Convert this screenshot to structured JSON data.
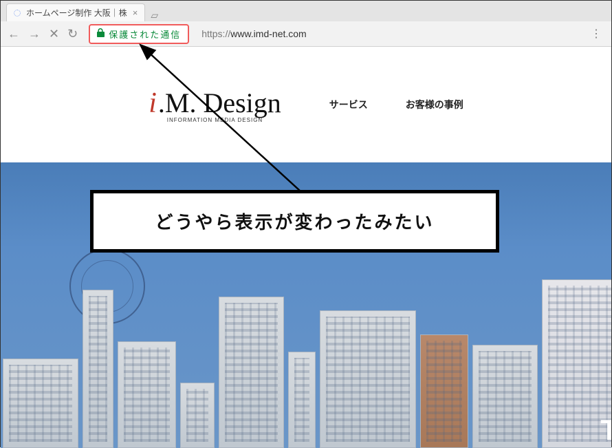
{
  "browser": {
    "tab_title": "ホームページ制作 大阪｜株",
    "secure_label": "保護された通信",
    "url_prefix": "https://",
    "url_domain": "www.imd-net.com"
  },
  "site": {
    "logo_i": "i",
    "logo_rest": ".M. Design",
    "logo_sub": "INFORMATION MEDIA DESIGN",
    "nav1": "サービス",
    "nav2": "お客様の事例"
  },
  "annotation": {
    "text": "どうやら表示が変わったみたい"
  },
  "corner": "T"
}
